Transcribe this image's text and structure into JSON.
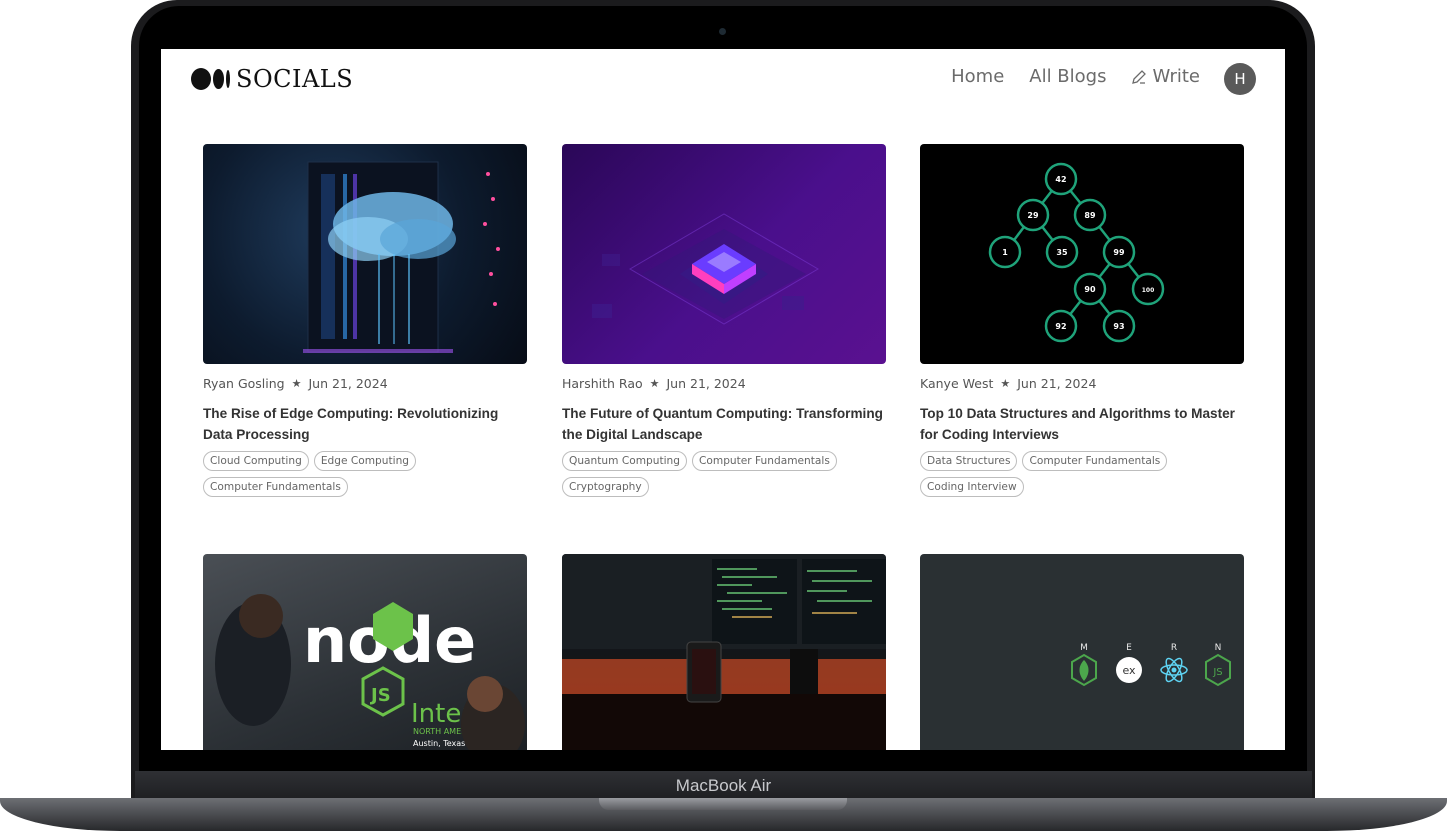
{
  "device": {
    "base_label": "MacBook Air"
  },
  "nav": {
    "logo_text": "SOCIALS",
    "links": [
      "Home",
      "All Blogs",
      "Write"
    ],
    "avatar_initial": "H"
  },
  "posts": [
    {
      "author": "Ryan Gosling",
      "date": "Jun 21, 2024",
      "title": "The Rise of Edge Computing: Revolutionizing Data Processing",
      "tags": [
        "Cloud Computing",
        "Edge Computing",
        "Computer Fundamentals"
      ]
    },
    {
      "author": "Harshith Rao",
      "date": "Jun 21, 2024",
      "title": "The Future of Quantum Computing: Transforming the Digital Landscape",
      "tags": [
        "Quantum Computing",
        "Computer Fundamentals",
        "Cryptography"
      ]
    },
    {
      "author": "Kanye West",
      "date": "Jun 21, 2024",
      "title": "Top 10 Data Structures and Algorithms to Master for Coding Interviews",
      "tags": [
        "Data Structures",
        "Computer Fundamentals",
        "Coding Interview"
      ]
    }
  ],
  "tree_nodes": [
    "42",
    "29",
    "89",
    "1",
    "35",
    "99",
    "90",
    "100",
    "92",
    "93"
  ],
  "node_image": {
    "word": "node",
    "sub": "Intera",
    "region": "NORTH AMERIC",
    "city": "Austin, Texas"
  },
  "mern": {
    "letters": [
      "M",
      "E",
      "R",
      "N"
    ],
    "express_text": "ex"
  },
  "colors": {
    "accent_green": "#1fa37a",
    "node_green": "#6cc24a",
    "quantum_bg": "#3a0a6e"
  }
}
